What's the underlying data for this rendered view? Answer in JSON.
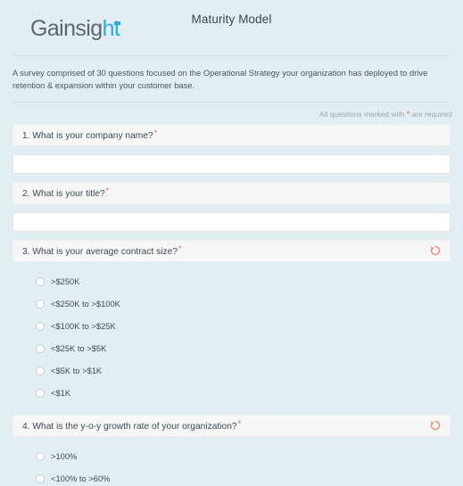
{
  "header": {
    "logo": {
      "name": "Gainsight",
      "part_dark": "Gainsig",
      "part_accent": "ht",
      "color_dark": "#5b6670",
      "color_accent": "#29abe2"
    },
    "survey_title": "Maturity Model"
  },
  "intro": {
    "description": "A survey comprised of 30 questions focused on the Operational Strategy your organization has deployed to drive retention & expansion within your customer base.",
    "required_note_before": "All questions marked with ",
    "required_note_star": "*",
    "required_note_after": " are required"
  },
  "theme": {
    "page_background": "#e2eef2",
    "question_header_background": "#f7f7f7",
    "question_text_color": "#3b4859",
    "required_star_color": "#e8615a",
    "reset_icon_color": "#f08a72",
    "input_background": "#ffffff"
  },
  "questions": [
    {
      "number": "1.",
      "text": "1. What is your company name?",
      "required": "*",
      "type": "text",
      "value": "",
      "placeholder": "",
      "has_reset": false
    },
    {
      "number": "2.",
      "text": "2. What is your title?",
      "required": "*",
      "type": "text",
      "value": "",
      "placeholder": "",
      "has_reset": false
    },
    {
      "number": "3.",
      "text": "3. What is your average contract size?",
      "required": "*",
      "type": "radio",
      "has_reset": true,
      "reset_label": "Reset answer",
      "options": [
        ">$250K",
        "<$250K to >$100K",
        "<$100K to >$25K",
        "<$25K to >$5K",
        "<$5K to >$1K",
        "<$1K"
      ]
    },
    {
      "number": "4.",
      "text": "4. What is the y-o-y growth rate of your organization?",
      "required": "*",
      "type": "radio",
      "has_reset": true,
      "reset_label": "Reset answer",
      "options": [
        ">100%",
        "<100% to >60%"
      ]
    }
  ]
}
